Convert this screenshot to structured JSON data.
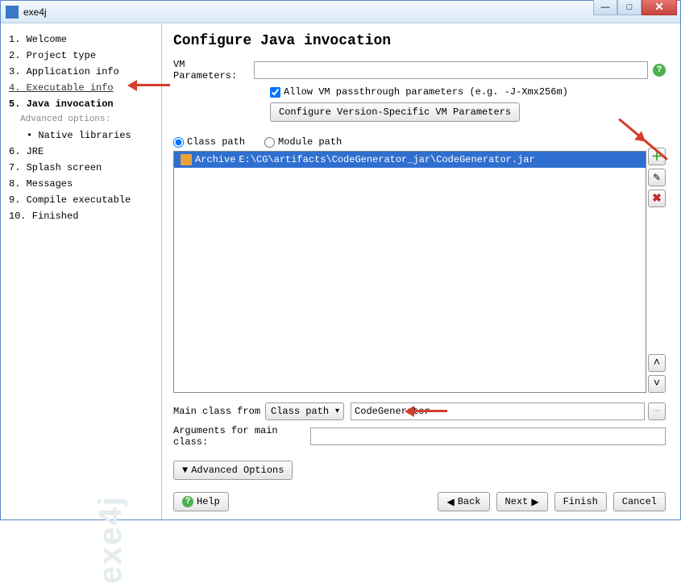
{
  "window": {
    "title": "exe4j"
  },
  "sidebar": {
    "steps": [
      "1. Welcome",
      "2. Project type",
      "3. Application info",
      "4. Executable info",
      "5. Java invocation",
      "Advanced options:",
      "• Native libraries",
      "6. JRE",
      "7. Splash screen",
      "8. Messages",
      "9. Compile executable",
      "10. Finished"
    ],
    "watermark": "exe4j"
  },
  "main": {
    "heading": "Configure Java invocation",
    "vm_label": "VM Parameters:",
    "vm_value": "",
    "allow_passthrough": "Allow VM passthrough parameters (e.g. -J-Xmx256m)",
    "cfg_version_btn": "Configure Version-Specific VM Parameters",
    "radio_classpath": "Class path",
    "radio_modulepath": "Module path",
    "entry_prefix": "Archive",
    "entry_path": "E:\\CG\\artifacts\\CodeGenerator_jar\\CodeGenerator.jar",
    "mainclass_label": "Main class from",
    "mainclass_dropdown": "Class path",
    "mainclass_value": "CodeGenerator",
    "args_label": "Arguments for main class:",
    "args_value": "",
    "adv_options_btn": "Advanced Options",
    "help_btn": "Help",
    "back_btn": "Back",
    "next_btn": "Next",
    "finish_btn": "Finish",
    "cancel_btn": "Cancel"
  }
}
